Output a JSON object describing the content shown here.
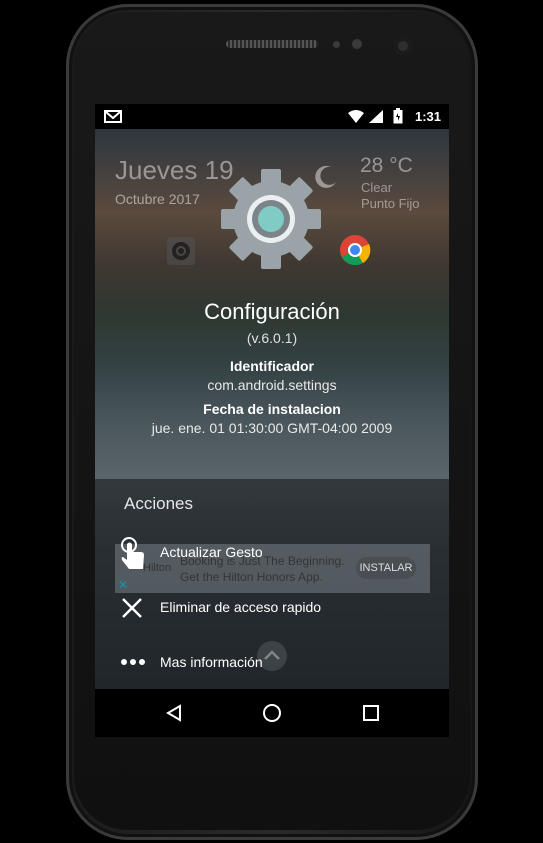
{
  "status_bar": {
    "time": "1:31"
  },
  "widget": {
    "day": "Jueves 19",
    "month": "Octubre 2017",
    "temperature": "28 °C",
    "condition": "Clear",
    "location": "Punto Fijo"
  },
  "app": {
    "name": "Configuración",
    "version": "(v.6.0.1)",
    "id_label": "Identificador",
    "id_value": "com.android.settings",
    "install_label": "Fecha de instalacion",
    "install_value": "jue. ene. 01 01:30:00 GMT-04:00 2009"
  },
  "actions": {
    "title": "Acciones",
    "items": [
      {
        "label": "Actualizar Gesto",
        "icon": "touch-gesture-icon"
      },
      {
        "label": "Eliminar de acceso rapido",
        "icon": "close-icon"
      },
      {
        "label": "Mas información",
        "icon": "more-horiz-icon"
      }
    ]
  },
  "ad": {
    "brand": "Hilton",
    "line1": "Booking is Just The Beginning.",
    "line2": "Get the Hilton Honors App.",
    "button": "INSTALAR"
  },
  "colors": {
    "gear_gray": "#9aa3a8",
    "gear_accent": "#80cbc4",
    "background_black": "#000000"
  }
}
